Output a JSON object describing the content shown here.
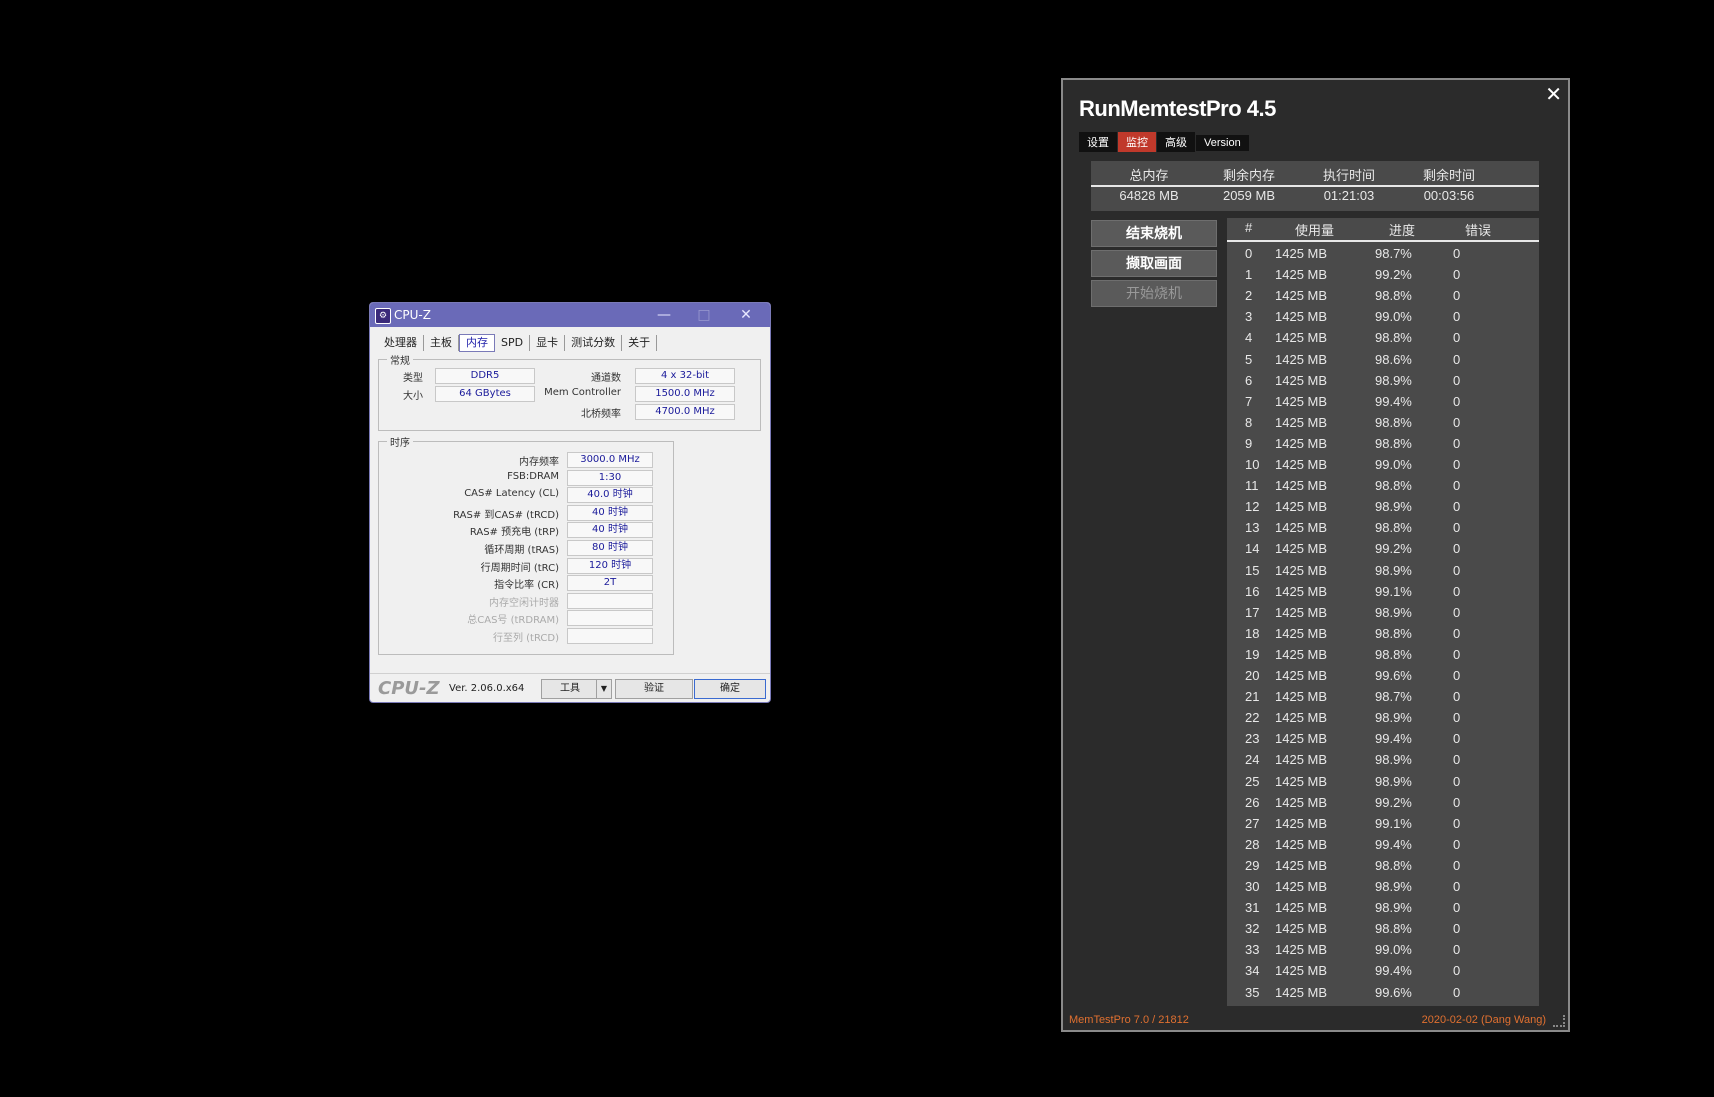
{
  "cpuz": {
    "title": "CPU-Z",
    "window_buttons": {
      "minimize": "—",
      "maximize": "□",
      "close": "✕"
    },
    "tabs": [
      "处理器",
      "主板",
      "内存",
      "SPD",
      "显卡",
      "测试分数",
      "关于"
    ],
    "general": {
      "legend": "常规",
      "type_label": "类型",
      "type_value": "DDR5",
      "size_label": "大小",
      "size_value": "64 GBytes",
      "channels_label": "通道数",
      "channels_value": "4 x 32-bit",
      "memctrl_label": "Mem Controller",
      "memctrl_value": "1500.0 MHz",
      "nb_label": "北桥频率",
      "nb_value": "4700.0 MHz"
    },
    "timings": {
      "legend": "时序",
      "rows": [
        {
          "label": "内存频率",
          "value": "3000.0 MHz"
        },
        {
          "label": "FSB:DRAM",
          "value": "1:30"
        },
        {
          "label": "CAS# Latency (CL)",
          "value": "40.0 时钟"
        },
        {
          "label": "RAS# 到CAS# (tRCD)",
          "value": "40 时钟"
        },
        {
          "label": "RAS# 预充电 (tRP)",
          "value": "40 时钟"
        },
        {
          "label": "循环周期 (tRAS)",
          "value": "80 时钟"
        },
        {
          "label": "行周期时间 (tRC)",
          "value": "120 时钟"
        },
        {
          "label": "指令比率 (CR)",
          "value": "2T"
        },
        {
          "label": "内存空闲计时器",
          "value": ""
        },
        {
          "label": "总CAS号 (tRDRAM)",
          "value": ""
        },
        {
          "label": "行至列 (tRCD)",
          "value": ""
        }
      ]
    },
    "logo": "CPU-Z",
    "version": "Ver. 2.06.0.x64",
    "tools_button": "工具",
    "tools_arrow": "▼",
    "validate_button": "验证",
    "ok_button": "确定"
  },
  "runmemtest": {
    "close": "✕",
    "title": "RunMemtestPro 4.5",
    "tabs": [
      "设置",
      "监控",
      "高级",
      "Version"
    ],
    "active_tab": 1,
    "summary": {
      "headers": [
        "总内存",
        "剩余内存",
        "执行时间",
        "剩余时间"
      ],
      "values": [
        "64828 MB",
        "2059 MB",
        "01:21:03",
        "00:03:56"
      ]
    },
    "buttons": {
      "stop": "结束烧机",
      "capture": "撷取画面",
      "start": "开始烧机"
    },
    "table": {
      "headers": [
        "#",
        "使用量",
        "进度",
        "错误"
      ],
      "rows": [
        [
          "0",
          "1425 MB",
          "98.7%",
          "0"
        ],
        [
          "1",
          "1425 MB",
          "99.2%",
          "0"
        ],
        [
          "2",
          "1425 MB",
          "98.8%",
          "0"
        ],
        [
          "3",
          "1425 MB",
          "99.0%",
          "0"
        ],
        [
          "4",
          "1425 MB",
          "98.8%",
          "0"
        ],
        [
          "5",
          "1425 MB",
          "98.6%",
          "0"
        ],
        [
          "6",
          "1425 MB",
          "98.9%",
          "0"
        ],
        [
          "7",
          "1425 MB",
          "99.4%",
          "0"
        ],
        [
          "8",
          "1425 MB",
          "98.8%",
          "0"
        ],
        [
          "9",
          "1425 MB",
          "98.8%",
          "0"
        ],
        [
          "10",
          "1425 MB",
          "99.0%",
          "0"
        ],
        [
          "11",
          "1425 MB",
          "98.8%",
          "0"
        ],
        [
          "12",
          "1425 MB",
          "98.9%",
          "0"
        ],
        [
          "13",
          "1425 MB",
          "98.8%",
          "0"
        ],
        [
          "14",
          "1425 MB",
          "99.2%",
          "0"
        ],
        [
          "15",
          "1425 MB",
          "98.9%",
          "0"
        ],
        [
          "16",
          "1425 MB",
          "99.1%",
          "0"
        ],
        [
          "17",
          "1425 MB",
          "98.9%",
          "0"
        ],
        [
          "18",
          "1425 MB",
          "98.8%",
          "0"
        ],
        [
          "19",
          "1425 MB",
          "98.8%",
          "0"
        ],
        [
          "20",
          "1425 MB",
          "99.6%",
          "0"
        ],
        [
          "21",
          "1425 MB",
          "98.7%",
          "0"
        ],
        [
          "22",
          "1425 MB",
          "98.9%",
          "0"
        ],
        [
          "23",
          "1425 MB",
          "99.4%",
          "0"
        ],
        [
          "24",
          "1425 MB",
          "98.9%",
          "0"
        ],
        [
          "25",
          "1425 MB",
          "98.9%",
          "0"
        ],
        [
          "26",
          "1425 MB",
          "99.2%",
          "0"
        ],
        [
          "27",
          "1425 MB",
          "99.1%",
          "0"
        ],
        [
          "28",
          "1425 MB",
          "99.4%",
          "0"
        ],
        [
          "29",
          "1425 MB",
          "98.8%",
          "0"
        ],
        [
          "30",
          "1425 MB",
          "98.9%",
          "0"
        ],
        [
          "31",
          "1425 MB",
          "98.9%",
          "0"
        ],
        [
          "32",
          "1425 MB",
          "98.8%",
          "0"
        ],
        [
          "33",
          "1425 MB",
          "99.0%",
          "0"
        ],
        [
          "34",
          "1425 MB",
          "99.4%",
          "0"
        ],
        [
          "35",
          "1425 MB",
          "99.6%",
          "0"
        ]
      ]
    },
    "footer_left": "MemTestPro 7.0 / 21812",
    "footer_right": "2020-02-02 (Dang Wang)",
    "accent_color": "#c0392b"
  }
}
